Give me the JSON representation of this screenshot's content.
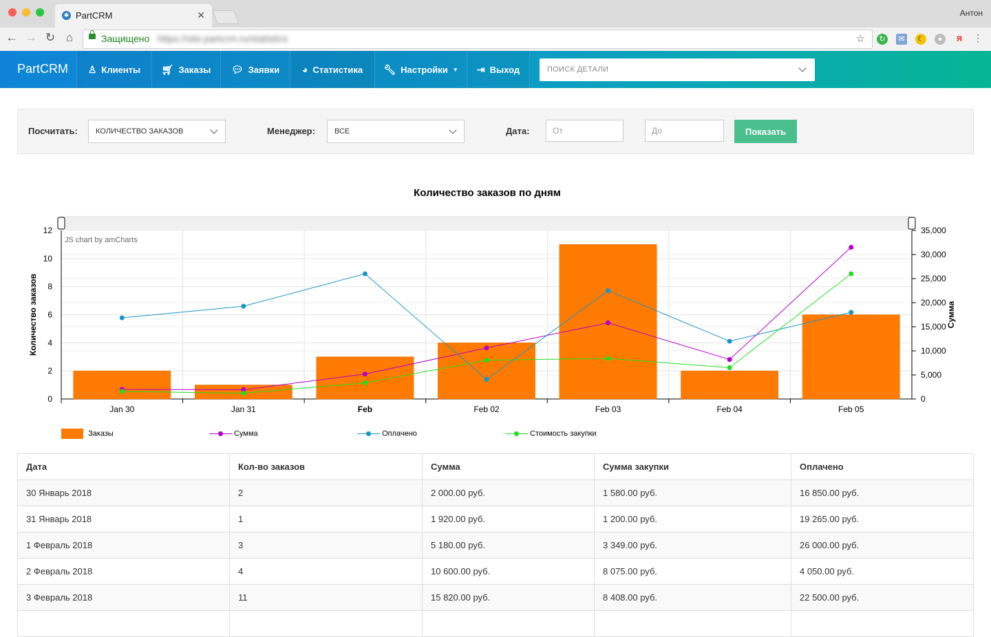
{
  "browser": {
    "tab_title": "PartCRM",
    "profile": "Антон",
    "secure_label": "Защищено",
    "url": "https://site.partcrm.ru/statistics"
  },
  "nav": {
    "brand": "PartCRM",
    "items": [
      {
        "label": "Клиенты",
        "icon": "user-icon"
      },
      {
        "label": "Заказы",
        "icon": "cart-icon"
      },
      {
        "label": "Заявки",
        "icon": "chat-icon"
      },
      {
        "label": "Статистика",
        "icon": "pie-chart-icon"
      },
      {
        "label": "Настройки",
        "icon": "wrench-icon"
      },
      {
        "label": "Выход",
        "icon": "logout-icon"
      }
    ],
    "search_placeholder": "ПОИСК ДЕТАЛИ"
  },
  "filters": {
    "count_label": "Посчитать:",
    "count_value": "КОЛИЧЕСТВО ЗАКАЗОВ",
    "manager_label": "Менеджер:",
    "manager_value": "ВСЕ",
    "date_label": "Дата:",
    "date_from_placeholder": "От",
    "date_to_placeholder": "До",
    "show_button": "Показать"
  },
  "chart_data": {
    "type": "bar",
    "title": "Количество заказов по дням",
    "credit": "JS chart by amCharts",
    "categories": [
      "Jan 30",
      "Jan 31",
      "Feb",
      "Feb 02",
      "Feb 03",
      "Feb 04",
      "Feb 05"
    ],
    "ylabel": "Количество заказов",
    "ylabel_right": "Сумма",
    "ylim": [
      0,
      12
    ],
    "ylim_right": [
      0,
      35000
    ],
    "yticks": [
      "0",
      "2",
      "4",
      "6",
      "8",
      "10",
      "12"
    ],
    "yticks_right": [
      "0",
      "5,000",
      "10,000",
      "15,000",
      "20,000",
      "25,000",
      "30,000",
      "35,000"
    ],
    "grid": true,
    "legend_position": "bottom",
    "series": [
      {
        "name": "Заказы",
        "type": "bar",
        "axis": "left",
        "color": "#ff7a00",
        "values": [
          2,
          1,
          3,
          4,
          11,
          2,
          6
        ]
      },
      {
        "name": "Сумма",
        "type": "line",
        "axis": "right",
        "color": "#b300cc",
        "values": [
          2000,
          1920,
          5180,
          10600,
          15820,
          8200,
          31500
        ]
      },
      {
        "name": "Оплачено",
        "type": "line",
        "axis": "right",
        "color": "#1a95c9",
        "values": [
          16850,
          19265,
          26000,
          4050,
          22500,
          12000,
          18000
        ]
      },
      {
        "name": "Стоимость закупки",
        "type": "line",
        "axis": "right",
        "color": "#22dd22",
        "values": [
          1580,
          1200,
          3349,
          8075,
          8408,
          6500,
          26000
        ]
      }
    ]
  },
  "table": {
    "headers": [
      "Дата",
      "Кол-во заказов",
      "Сумма",
      "Сумма закупки",
      "Оплачено"
    ],
    "rows": [
      [
        "30 Январь 2018",
        "2",
        "2 000.00 руб.",
        "1 580.00 руб.",
        "16 850.00 руб."
      ],
      [
        "31 Январь 2018",
        "1",
        "1 920.00 руб.",
        "1 200.00 руб.",
        "19 265.00 руб."
      ],
      [
        "1 Февраль 2018",
        "3",
        "5 180.00 руб.",
        "3 349.00 руб.",
        "26 000.00 руб."
      ],
      [
        "2 Февраль 2018",
        "4",
        "10 600.00 руб.",
        "8 075.00 руб.",
        "4 050.00 руб."
      ],
      [
        "3 Февраль 2018",
        "11",
        "15 820.00 руб.",
        "8 408.00 руб.",
        "22 500.00 руб."
      ],
      [
        "",
        "",
        "",
        "",
        ""
      ]
    ]
  },
  "colors": {
    "accent": "#0f84d6",
    "accent_end": "#05b593",
    "button": "#4cbf8e"
  }
}
